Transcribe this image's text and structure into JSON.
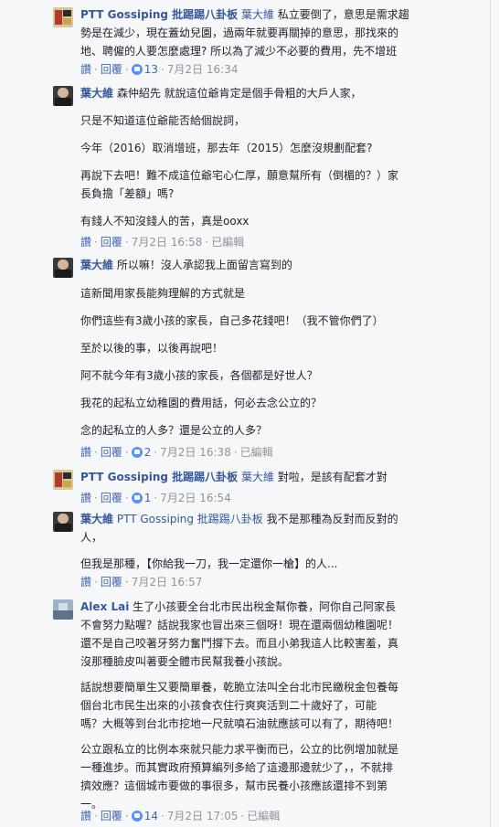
{
  "comments": [
    {
      "author": "PTT Gossiping 批踢踢八卦板",
      "tag": "葉大維",
      "first_text": " 私立要倒了，意思是需求趨",
      "more_lines": [
        "勢是在減少，現在蓋幼兒園，過兩年就要再關掉的意思，那找來的",
        "地、聘僱的人要怎麼處理? 所以為了減少不必要的費用，先不增班"
      ],
      "reply": "回覆",
      "like": "讚",
      "likes": "13",
      "date": "7月2日 16:34"
    },
    {
      "author": "葉大維",
      "first_text": " 森仲紹先 就說這位爺肯定是個手骨粗的大戶人家，",
      "paras": [
        "只是不知道這位爺能否給個說詞，",
        "今年（2016）取消增班，那去年（2015）怎麼沒規劃配套?",
        "再說下去吧！難不成這位爺宅心仁厚，願意幫所有（倒楣的？）家",
        "長負擔「差額」嗎?",
        "有錢人不知沒錢人的苦，真是ooxx"
      ],
      "like": "讚",
      "reply": "回覆",
      "date": "7月2日 16:58",
      "edited": "已編輯"
    },
    {
      "author": "葉大維",
      "first_text": " 所以嘛！沒人承認我上面留言寫到的",
      "paras": [
        "這新聞用家長能夠理解的方式就是",
        "你們這些有3歲小孩的家長，自己多花錢吧！（我不管你們了）",
        "至於以後的事，以後再說吧！",
        "阿不就今年有3歲小孩的家長，各個都是好世人？",
        "我花的起私立幼稚園的費用話，何必去念公立的？",
        "念的起私立的人多？還是公立的人多？"
      ],
      "like": "讚",
      "reply": "回覆",
      "likes": "2",
      "date": "7月2日 16:38",
      "edited": "已編輯"
    },
    {
      "author": "PTT Gossiping 批踢踢八卦板",
      "tag": "葉大維",
      "first_text": " 對啦，是該有配套才對",
      "like": "讚",
      "reply": "回覆",
      "likes": "1",
      "date": "7月2日 16:54"
    },
    {
      "author": "葉大維",
      "tag": "PTT Gossiping 批踢踢八卦板",
      "first_text": " 我不是那種為反對而反對的",
      "more_lines": [
        "人，"
      ],
      "paras": [
        "但我是那種，【你給我一刀，我一定還你一槍】的人..."
      ],
      "like": "讚",
      "reply": "回覆",
      "date": "7月2日 16:57"
    },
    {
      "author": "Alex Lai",
      "first_text": " 生了小孩要全台北市民出稅金幫你養，阿你自己阿家長",
      "more_lines": [
        "不會努力點喔？話說我家也冒出來三個呀！現在還兩個幼稚園呢！",
        "還不是自己咬著牙努力奮鬥撐下去。而且小弟我這人比較害羞，真",
        "沒那種臉皮叫著要全體市民幫我養小孩說。"
      ],
      "paras": [
        "話說想要簡單生又要簡單養，乾脆立法叫全台北市民繳稅金包養每",
        "個台北市民生出來的小孩食衣住行爽爽活到二十歲好了，可能",
        "嗎？大概等到台北市挖地一尺就噴石油就應該可以有了，期待吧！",
        "公立跟私立的比例本來就只能力求平衡而已，公立的比例增加就是",
        "一種進步。而其實政府預算編列多給了這邊那邊就少了，，不就排",
        "擠效應？這個城市要做的事很多，幫市民養小孩應該還排不到第",
        "一。"
      ],
      "like": "讚",
      "reply": "回覆",
      "likes": "14",
      "date": "7月2日 17:05",
      "edited": "已編輯"
    }
  ]
}
